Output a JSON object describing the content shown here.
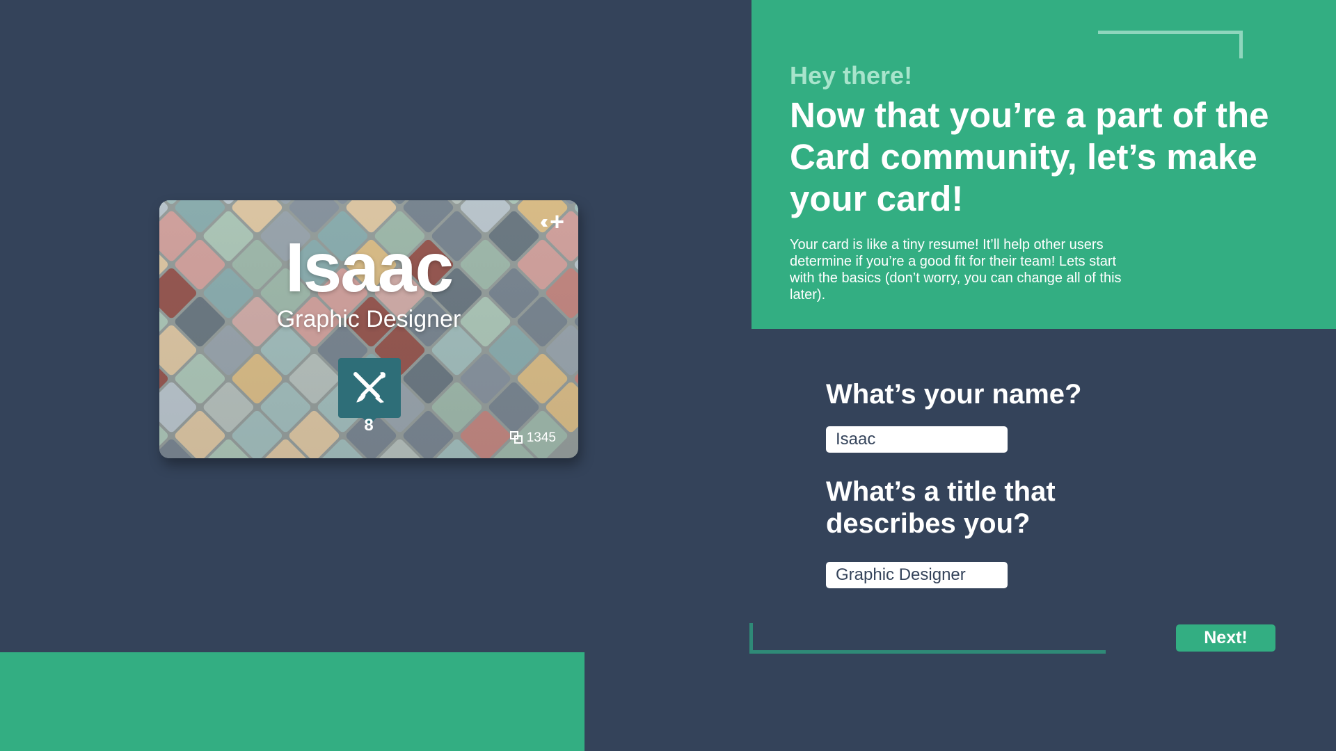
{
  "intro": {
    "greeting": "Hey there!",
    "headline": "Now that you’re a part of the Card community, let’s make your card!",
    "description": "Your card is like a tiny resume! It’ll help other users determine if you’re a good fit for their team! Lets start with the basics (don’t worry, you can change all of this later)."
  },
  "card": {
    "name": "Isaac",
    "title": "Graphic Designer",
    "skill_icon": "pen-brush-crossed-icon",
    "skill_count": "8",
    "views": "1345",
    "actions": {
      "back_icon": "triple-chevron-left-icon",
      "add_icon": "plus-icon"
    }
  },
  "form": {
    "name_question": "What’s your name?",
    "name_value": "Isaac",
    "title_question": "What’s a title that describes you?",
    "title_value": "Graphic Designer",
    "next_label": "Next!"
  },
  "colors": {
    "background": "#34435a",
    "accent_green": "#33ae82",
    "greeting_green": "#a8e4cc",
    "badge_teal": "#2e6e78"
  }
}
